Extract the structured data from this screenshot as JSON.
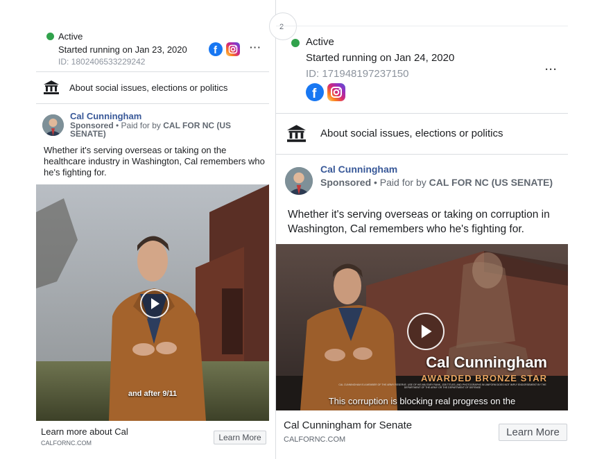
{
  "left": {
    "status": "Active",
    "started": "Started running on Jan 23, 2020",
    "ad_id": "ID: 1802406533229242",
    "more": "···",
    "category": "About social issues, elections or politics",
    "advertiser": "Cal Cunningham",
    "sponsored": "Sponsored",
    "paid_by_prefix": "• Paid for by",
    "paid_by": "CAL FOR NC (US SENATE)",
    "body": "Whether it's serving overseas or taking on the healthcare industry in Washington, Cal remembers who he's fighting for.",
    "video_caption": "and after 9/11",
    "cta_title": "Learn more about Cal",
    "cta_domain": "CALFORNC.COM",
    "cta_button": "Learn More"
  },
  "right": {
    "corner_badge": "2",
    "status": "Active",
    "started": "Started running on Jan 24, 2020",
    "ad_id": "ID: 171948197237150",
    "more": "···",
    "category": "About social issues, elections or politics",
    "advertiser": "Cal Cunningham",
    "sponsored": "Sponsored",
    "paid_by_prefix": "• Paid for by",
    "paid_by": "CAL FOR NC (US SENATE)",
    "body": "Whether it's serving overseas or taking on corruption in Washington, Cal remembers who he's fighting for.",
    "overlay_name": "Cal Cunningham",
    "overlay_award": "AWARDED BRONZE STAR",
    "overlay_fineprint": "CAL CUNNINGHAM IS A MEMBER OF THE ARMY RESERVE. USE OF HIS MILITARY RANK, JOB TITLES, AND PHOTOGRAPHS IN UNIFORM DOES NOT IMPLY ENDORSEMENT BY THE DEPARTMENT OF THE ARMY OR THE DEPARTMENT OF DEFENSE",
    "video_caption": "This corruption is blocking real progress on the",
    "cta_title": "Cal Cunningham for Senate",
    "cta_domain": "CALFORNC.COM",
    "cta_button": "Learn More"
  },
  "colors": {
    "active": "#31a24c",
    "facebook": "#1877f2",
    "link": "#385898"
  },
  "icons": [
    "facebook-icon",
    "instagram-icon",
    "more-options-icon",
    "government-building-icon",
    "play-icon"
  ]
}
